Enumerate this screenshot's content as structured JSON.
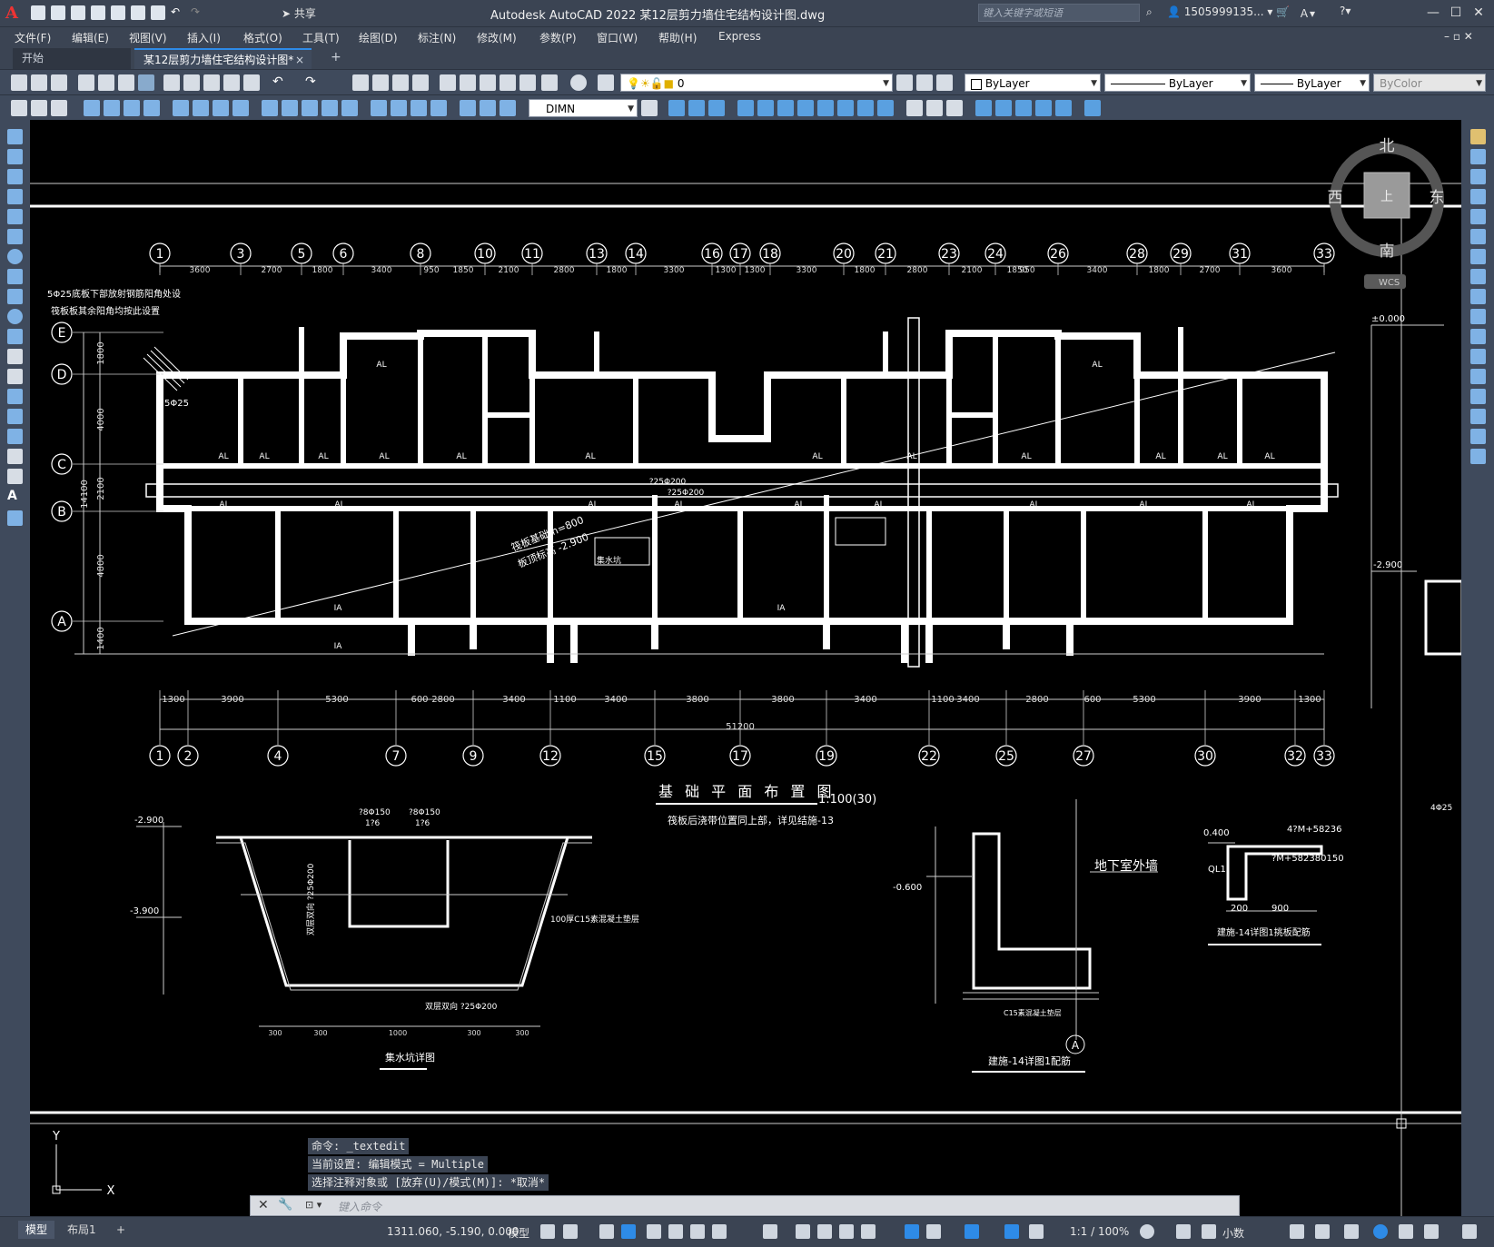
{
  "app": {
    "title": "Autodesk AutoCAD 2022    某12层剪力墙住宅结构设计图.dwg",
    "share_label": "共享",
    "search_placeholder": "键入关键字或短语",
    "user_name": "1505999135...",
    "logo": "A"
  },
  "menu": [
    "文件(F)",
    "编辑(E)",
    "视图(V)",
    "插入(I)",
    "格式(O)",
    "工具(T)",
    "绘图(D)",
    "标注(N)",
    "修改(M)",
    "参数(P)",
    "窗口(W)",
    "帮助(H)",
    "Express"
  ],
  "tabs": {
    "start": "开始",
    "active": "某12层剪力墙住宅结构设计图*",
    "close": "×",
    "add": "+"
  },
  "toolbar": {
    "layer_value": "0",
    "color_value": "ByLayer",
    "linetype_value": "ByLayer",
    "lineweight_value": "ByLayer",
    "plotstyle_value": "ByColor",
    "dimstyle_value": "DIMN"
  },
  "viewcube": {
    "north": "北",
    "south": "南",
    "east": "东",
    "west": "西",
    "top": "上",
    "wcs": "WCS"
  },
  "drawing": {
    "grid_top": [
      "1",
      "3",
      "5",
      "6",
      "8",
      "10",
      "11",
      "13",
      "14",
      "16",
      "17",
      "18",
      "20",
      "21",
      "23",
      "24",
      "26",
      "28",
      "29",
      "31",
      "33"
    ],
    "grid_bottom": [
      "1",
      "2",
      "4",
      "7",
      "9",
      "12",
      "15",
      "17",
      "19",
      "22",
      "25",
      "27",
      "30",
      "32",
      "33"
    ],
    "grid_rows": [
      "E",
      "D",
      "C",
      "B",
      "A"
    ],
    "dims_top": [
      "3600",
      "2700",
      "1800",
      "3400",
      "950",
      "1850",
      "2100",
      "2800",
      "1800",
      "3300",
      "1300",
      "1300",
      "3300",
      "1800",
      "2800",
      "2100",
      "1850",
      "950",
      "3400",
      "1800",
      "2700",
      "3600"
    ],
    "dims_bottom": [
      "1300",
      "3900",
      "5300",
      "600",
      "2800",
      "3400",
      "1100",
      "3400",
      "3800",
      "3800",
      "3400",
      "1100",
      "3400",
      "2800",
      "600",
      "5300",
      "3900",
      "1300"
    ],
    "total_dim": "51200",
    "left_dims": [
      "1800",
      "4000",
      "2100",
      "14100",
      "4800",
      "1400"
    ],
    "plan_title": "基 础 平 面 布 置 图",
    "plan_scale": "1:100(30)",
    "plan_note": "筏板后浇带位置同上部，详见结施-13",
    "note_left_1": "5Φ25底板下部放射钢筋阳角处设",
    "note_left_2": "筏板板其余阳角均按此设置",
    "label_5d25": "5Φ25",
    "raft_label_1": "筏板基础  h=800",
    "raft_label_2": "板顶标高  -2.900",
    "pit_label": "集水坑",
    "rebar_label_1": "?25Φ200",
    "rebar_label_2": "?25Φ200",
    "al": "AL",
    "ia": "IA",
    "elev_0": "±0.000",
    "elev_2900": "-2.900",
    "detail1_title": "集水坑详图",
    "detail1_elev1": "-2.900",
    "detail1_elev2": "-3.900",
    "detail1_top1": "?8Φ150",
    "detail1_top2": "?8Φ150",
    "detail1_ratio": "1?6",
    "detail1_cushion": "100厚C15素混凝土垫层",
    "detail1_bottom_rebar": "双层双向 ?25Φ200",
    "detail1_side": "双层双向 ?25Φ200",
    "detail1_dims": [
      "300",
      "300",
      "1000",
      "300",
      "300"
    ],
    "detail2_title": "建施-14详图1配筋",
    "detail2_label": "地下室外墙",
    "detail2_elev": "-0.600",
    "detail2_axis": "A",
    "detail2_c15": "C15素混凝土垫层",
    "detail3_title": "建施-14详图1挑板配筋",
    "detail3_elev": "0.400",
    "detail3_ql": "QL1",
    "detail3_r1": "4?M+58236",
    "detail3_r2": "?M+582380150",
    "detail3_d1": "200",
    "detail3_d2": "900",
    "detail_right_1": "4Φ25"
  },
  "ucs": {
    "y": "Y",
    "x": "X"
  },
  "command": {
    "line1": "命令: _textedit",
    "line2": "当前设置: 编辑模式 = Multiple",
    "line3": "选择注释对象或 [放弃(U)/模式(M)]: *取消*",
    "placeholder": "键入命令",
    "prompt_icon": "⊡ ▾"
  },
  "status": {
    "model_tab": "模型",
    "layout_tab": "布局1",
    "add_tab": "+",
    "coords": "1311.060, -5.190, 0.000",
    "model_label": "模型",
    "scale": "1:1 / 100%",
    "units": "小数"
  },
  "colors": {
    "titlebar": "#3b4453",
    "toolbar": "#3f4a5c",
    "canvas": "#000000",
    "accent": "#2e8be7",
    "logo_red": "#e33333"
  }
}
